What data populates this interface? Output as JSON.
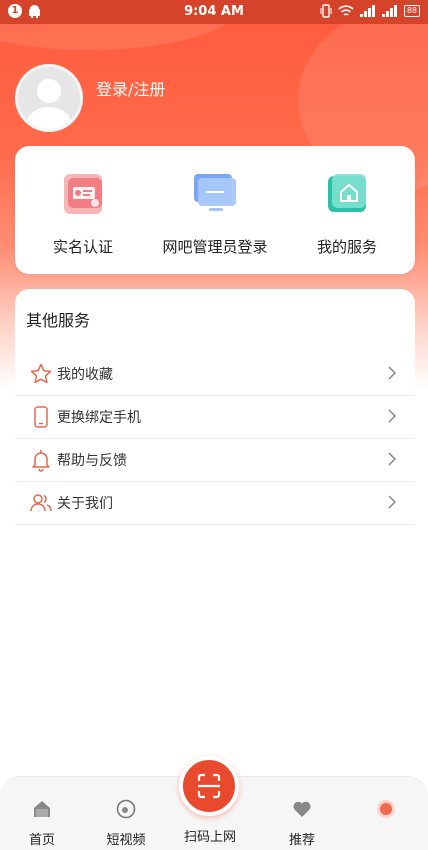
{
  "status_bar": {
    "time": "9:04 AM",
    "notification_count": "1",
    "battery": "88"
  },
  "profile": {
    "login_label": "登录/注册"
  },
  "services": [
    {
      "label": "实名认证",
      "icon": "id-card-icon"
    },
    {
      "label": "网吧管理员登录",
      "icon": "monitor-icon"
    },
    {
      "label": "我的服务",
      "icon": "home-icon"
    }
  ],
  "other_services": {
    "title": "其他服务",
    "items": [
      {
        "label": "我的收藏",
        "icon": "star-icon"
      },
      {
        "label": "更换绑定手机",
        "icon": "phone-icon"
      },
      {
        "label": "帮助与反馈",
        "icon": "bell-icon"
      },
      {
        "label": "关于我们",
        "icon": "users-icon"
      }
    ]
  },
  "tab_bar": {
    "tabs": [
      {
        "label": "首页",
        "icon": "home-tab-icon"
      },
      {
        "label": "短视频",
        "icon": "video-tab-icon"
      },
      {
        "label": "推荐",
        "icon": "heart-tab-icon"
      },
      {
        "label": "",
        "icon": "profile-tab-icon"
      }
    ],
    "scan_label": "扫码上网"
  },
  "colors": {
    "accent": "#e94a2e",
    "hero_top": "#ff5a3c",
    "icon_line": "#e5694f"
  }
}
